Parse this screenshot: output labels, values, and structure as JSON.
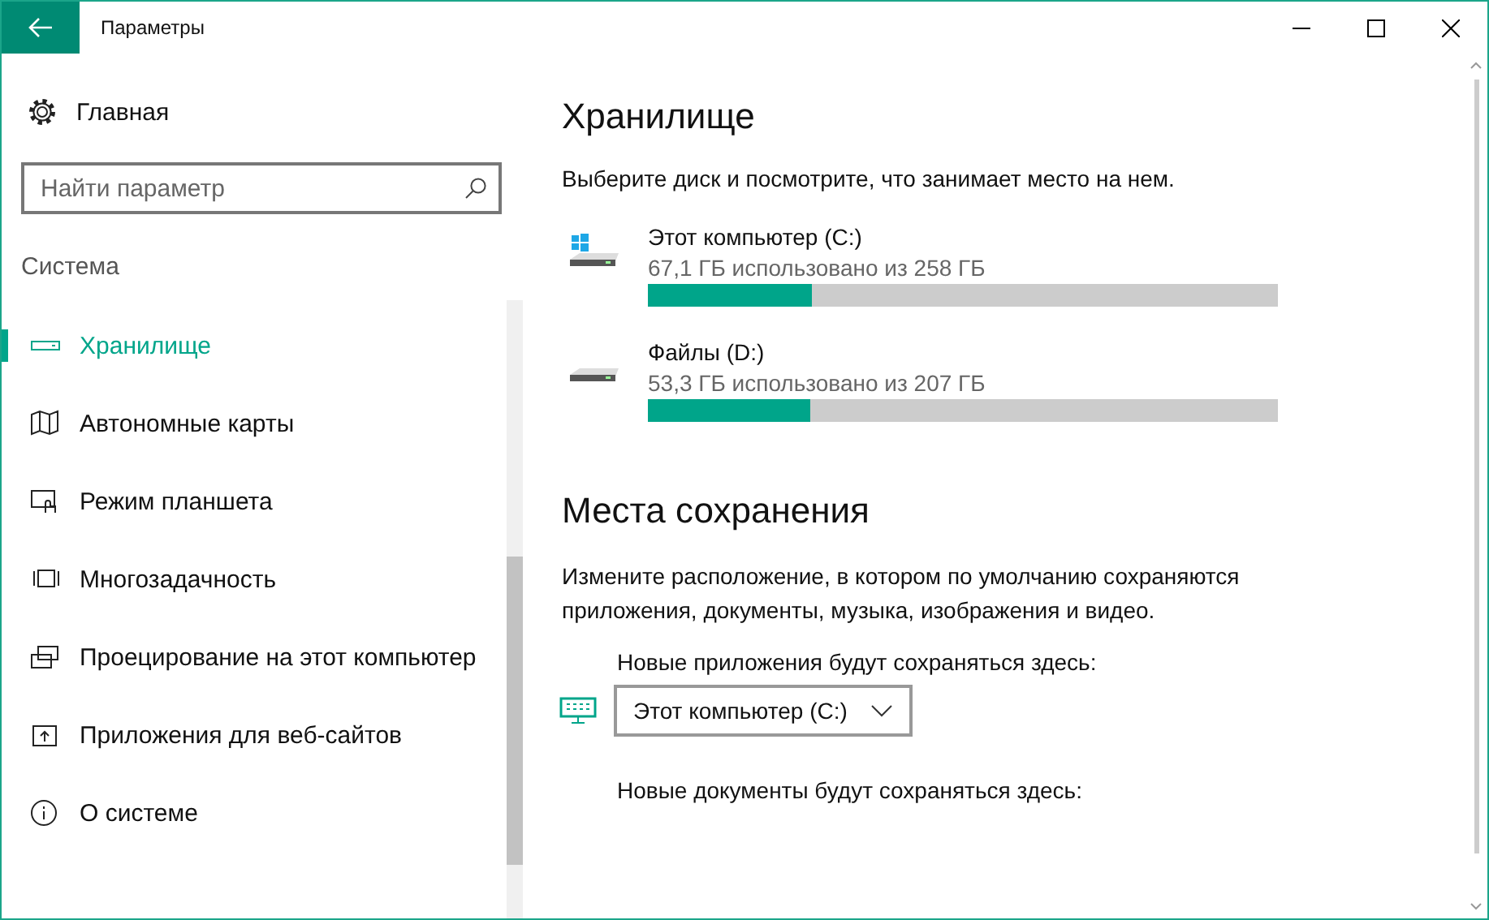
{
  "window": {
    "title": "Параметры"
  },
  "sidebar": {
    "home": "Главная",
    "search": {
      "placeholder": "Найти параметр"
    },
    "section": "Система",
    "items": [
      {
        "label": "Хранилище",
        "kind": "storage",
        "selected": true
      },
      {
        "label": "Автономные карты",
        "kind": "maps",
        "selected": false
      },
      {
        "label": "Режим планшета",
        "kind": "tablet",
        "selected": false
      },
      {
        "label": "Многозадачность",
        "kind": "multitask",
        "selected": false
      },
      {
        "label": "Проецирование на этот компьютер",
        "kind": "project",
        "selected": false
      },
      {
        "label": "Приложения для веб-сайтов",
        "kind": "webapps",
        "selected": false
      },
      {
        "label": "О системе",
        "kind": "about",
        "selected": false
      }
    ]
  },
  "storage": {
    "title": "Хранилище",
    "description": "Выберите диск и посмотрите, что занимает место на нем.",
    "drives": [
      {
        "name": "Этот компьютер (C:)",
        "kind": "system",
        "usage": "67,1 ГБ использовано из 258 ГБ",
        "level": 0.26
      },
      {
        "name": "Файлы (D:)",
        "kind": "data",
        "usage": "53,3 ГБ использовано из 207 ГБ",
        "level": 0.257
      }
    ]
  },
  "save_locations": {
    "title": "Места сохранения",
    "description": "Измените расположение, в котором по умолчанию сохраняются приложения, документы, музыка, изображения и видео.",
    "rows": [
      {
        "label": "Новые приложения будут сохраняться здесь:",
        "value": "Этот компьютер (C:)"
      },
      {
        "label": "Новые документы будут сохраняться здесь:"
      }
    ]
  }
}
